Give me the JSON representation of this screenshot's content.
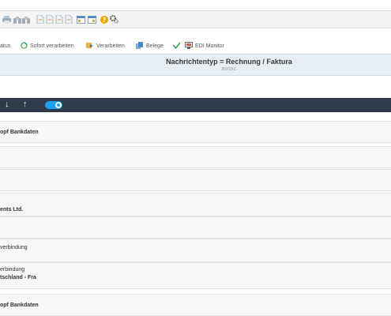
{
  "toolbar_icons": [
    "printer-icon",
    "binoculars-icon",
    "binoculars-icon",
    "document-icon",
    "document-icon",
    "document-icon",
    "document-icon",
    "window-icon",
    "window-icon",
    "help-icon",
    "settings-icon"
  ],
  "actions": {
    "status_label": "atus",
    "sofort_verarbeiten_label": "Sofort verarbeiten",
    "verarbeiten_label": "Verarbeiten",
    "belege_label": "Belege",
    "edi_monitor_label": "EDI Monitor"
  },
  "message_type": {
    "title": "Nachrichtentyp = Rechnung / Faktura",
    "code": "INVOIC"
  },
  "rows": [
    {
      "text": "opf Bankdaten"
    },
    {
      "text": ""
    },
    {
      "text": ""
    },
    {
      "text": "ents Ltd."
    },
    {
      "text": ""
    },
    {
      "text": "verbindung"
    },
    {
      "line1": "erbindung",
      "line2": "tschland - Fra"
    },
    {
      "text": "opf Bankdaten"
    }
  ]
}
